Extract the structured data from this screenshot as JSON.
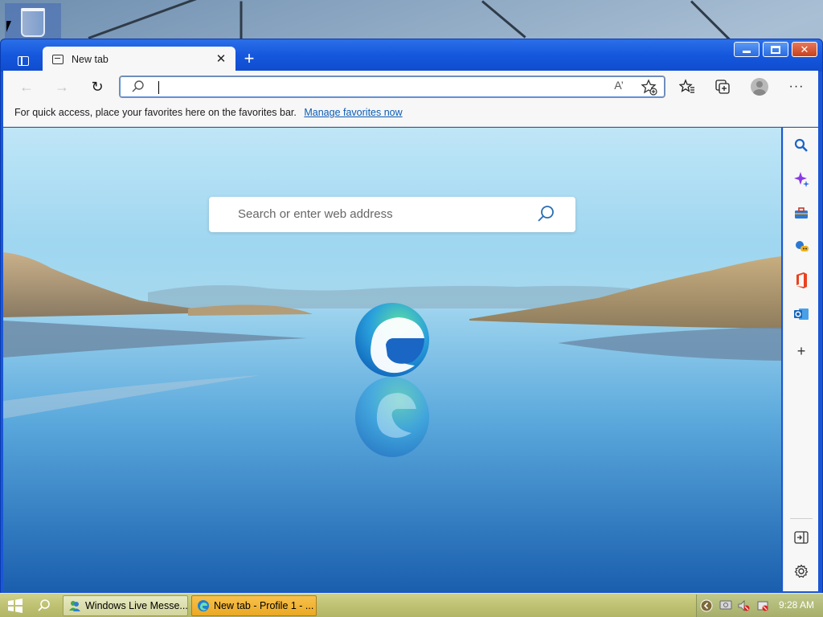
{
  "browser": {
    "tab": {
      "title": "New tab",
      "close_glyph": "✕"
    },
    "newtab_glyph": "+",
    "window_buttons": {
      "close_glyph": "✕"
    },
    "toolbar": {
      "back_glyph": "←",
      "forward_glyph": "→",
      "refresh_glyph": "↻",
      "address_value": "",
      "read_aloud_glyph": "A’",
      "menu_glyph": "···"
    },
    "favorites_bar": {
      "text": "For quick access, place your favorites here on the favorites bar.",
      "link": "Manage favorites now"
    },
    "page": {
      "search_placeholder": "Search or enter web address"
    },
    "sidebar": {
      "items": [
        {
          "name": "search",
          "icon": "search-icon"
        },
        {
          "name": "copilot",
          "icon": "sparkle-icon"
        },
        {
          "name": "tools",
          "icon": "toolbox-icon"
        },
        {
          "name": "games",
          "icon": "games-icon"
        },
        {
          "name": "office",
          "icon": "office-icon"
        },
        {
          "name": "outlook",
          "icon": "outlook-icon"
        },
        {
          "name": "add",
          "icon": "plus-icon",
          "glyph": "+"
        }
      ],
      "bottom": [
        {
          "name": "hide-sidebar",
          "icon": "sidebar-collapse-icon"
        },
        {
          "name": "settings",
          "icon": "gear-icon"
        }
      ]
    }
  },
  "taskbar": {
    "tasks": [
      {
        "label": "Windows Live Messe...",
        "icon": "messenger-icon",
        "active": false
      },
      {
        "label": "New tab - Profile 1 - ...",
        "icon": "edge-icon",
        "active": true
      }
    ],
    "clock": "9:28 AM"
  },
  "colors": {
    "titlebar": "#1557dc",
    "taskbar": "#c4c77a",
    "active_task": "#eba824",
    "link": "#0a5bb4"
  }
}
